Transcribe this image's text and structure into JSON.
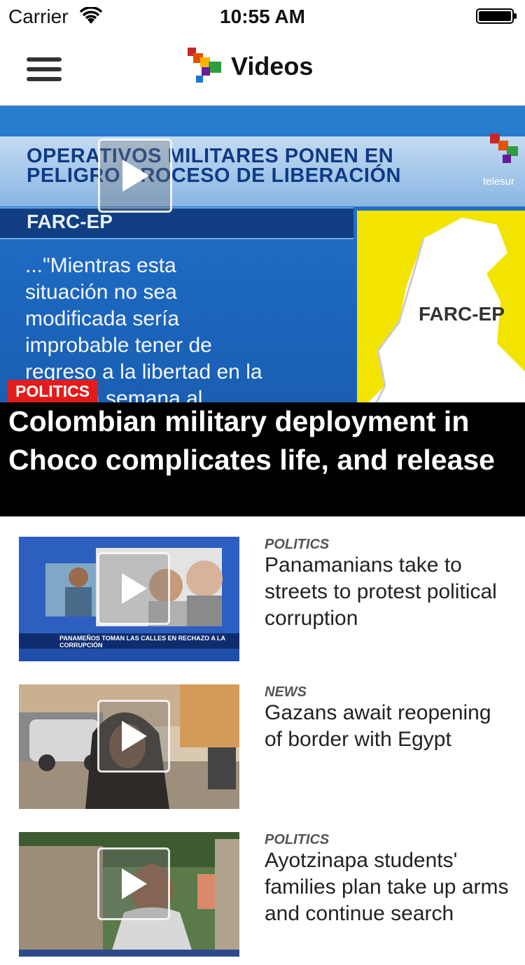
{
  "status_bar": {
    "carrier": "Carrier",
    "time": "10:55 AM"
  },
  "nav": {
    "title": "Videos"
  },
  "hero": {
    "category": "POLITICS",
    "title": "Colombian military deployment in Choco complicates life, and release",
    "thumbnail": {
      "headline": "OPERATIVOS MILITARES PONEN EN\nPELIGRO PROCESO DE LIBERACIÓN",
      "subject": "FARC-EP",
      "quote": "...\"Mientras esta\nsituación no sea\nmodificada sería\nimprobable tener  de\nregreso a la libertad en la\npróxima semana al",
      "map_label": "FARC-EP",
      "watermark": "telesur"
    }
  },
  "items": [
    {
      "category": "POLITICS",
      "title": "Panamanians take to streets to protest political corruption",
      "thumb_caption": "PANAMEÑOS TOMAN LAS CALLES EN RECHAZO A LA CORRUPCIÓN"
    },
    {
      "category": "NEWS",
      "title": "Gazans await reopening of border with Egypt"
    },
    {
      "category": "POLITICS",
      "title": "Ayotzinapa students' families plan take up arms and continue search"
    }
  ],
  "colors": {
    "accent_red": "#e31b1b",
    "nav_text": "#111111",
    "category_grey": "#555555"
  }
}
